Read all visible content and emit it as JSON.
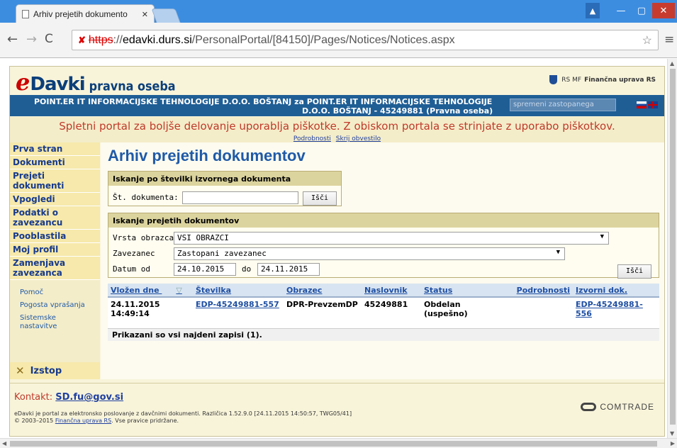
{
  "browser": {
    "tab_title": "Arhiv prejetih dokumento",
    "url_scheme": "https",
    "url_separator": "://",
    "url_host": "edavki.durs.si",
    "url_path": "/PersonalPortal/[84150]/Pages/Notices/Notices.aspx"
  },
  "header": {
    "logo_e": "e",
    "logo_name": "Davki",
    "logo_sub": "pravna oseba",
    "gov_text": "RS MF",
    "gov_name": "Finančna uprava RS",
    "taxpayer_line1": "POINT.ER IT INFORMACIJSKE TEHNOLOGIJE D.O.O. BOŠTANJ za POINT.ER IT INFORMACIJSKE TEHNOLOGIJE",
    "taxpayer_line2": "D.O.O. BOŠTANJ - 45249881 (Pravna oseba)",
    "change_placeholder": "spremeni zastopanega"
  },
  "cookie": {
    "message": "Spletni portal za boljše delovanje uporablja piškotke. Z obiskom portala se strinjate z uporabo piškotkov.",
    "details": "Podrobnosti",
    "hide": "Skrij obvestilo"
  },
  "nav": {
    "items": [
      "Prva stran",
      "Dokumenti",
      "Prejeti dokumenti",
      "Vpogledi",
      "Podatki o zavezancu",
      "Pooblastila",
      "Moj profil",
      "Zamenjava zavezanca"
    ],
    "sub": [
      "Pomoč",
      "Pogosta vprašanja",
      "Sistemske nastavitve"
    ],
    "exit": "Izstop"
  },
  "main": {
    "title": "Arhiv prejetih dokumentov",
    "search1": {
      "heading": "Iskanje po številki izvornega dokumenta",
      "label": "Št. dokumenta:",
      "value": "",
      "button": "Išči"
    },
    "search2": {
      "heading": "Iskanje prejetih dokumentov",
      "form_label": "Vrsta obrazca",
      "form_value": "VSI OBRAZCI",
      "taxpayer_label": "Zavezanec",
      "taxpayer_value": "Zastopani zavezanec",
      "date_label": "Datum od",
      "date_from": "24.10.2015",
      "date_to_label": "do",
      "date_to": "24.11.2015",
      "button": "Išči"
    },
    "table": {
      "columns": [
        "Vložen dne",
        "Številka",
        "Obrazec",
        "Naslovnik",
        "Status",
        "Podrobnosti",
        "Izvorni dok."
      ],
      "sort_indicator": "▽",
      "rows": [
        {
          "date": "24.11.2015 14:49:14",
          "number": "EDP-45249881-557",
          "form": "DPR-PrevzemDP",
          "recipient": "45249881",
          "status": "Obdelan (uspešno)",
          "details": "",
          "source": "EDP-45249881-556"
        }
      ],
      "footer": "Prikazani so vsi najdeni zapisi (1)."
    }
  },
  "footer": {
    "contact_label": "Kontakt:",
    "contact_email": "SD.fu@gov.si",
    "info_line1": "eDavki je portal za elektronsko poslovanje z davčnimi dokumenti. Različica 1.52.9.0 [24.11.2015 14:50:57, TWG05/41]",
    "info_copy": "© 2003–2015",
    "info_org": "Finančna uprava RS",
    "info_rights": ". Vse pravice pridržane.",
    "vendor": "COMTRADE"
  }
}
